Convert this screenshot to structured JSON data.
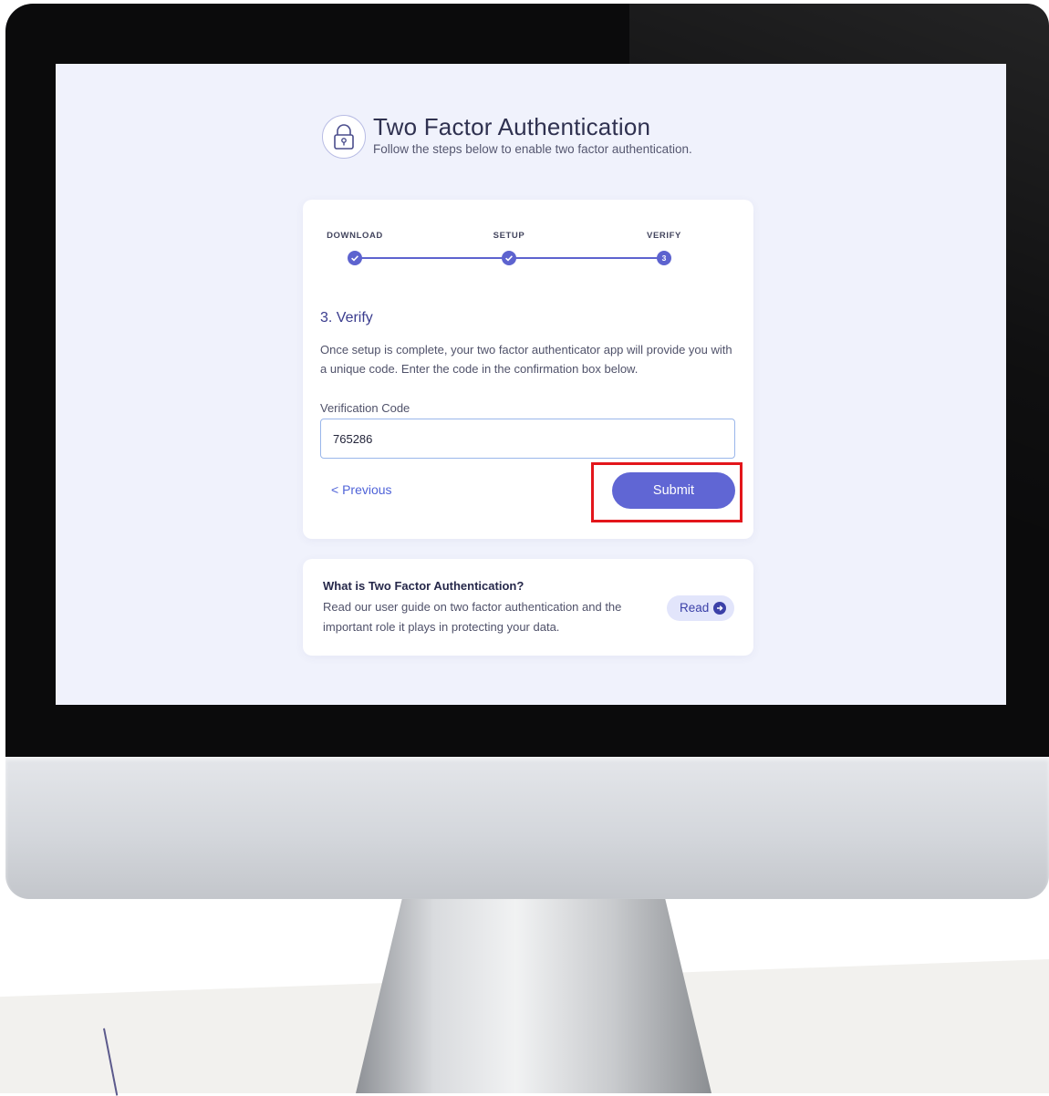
{
  "header": {
    "title": "Two Factor Authentication",
    "subtitle": "Follow the steps below to enable two factor authentication."
  },
  "stepper": {
    "steps": [
      {
        "label": "DOWNLOAD",
        "status": "complete"
      },
      {
        "label": "SETUP",
        "status": "complete"
      },
      {
        "label": "VERIFY",
        "status": "current",
        "number": "3"
      }
    ]
  },
  "verify": {
    "heading": "3. Verify",
    "description": "Once setup is complete, your two factor authenticator app will provide you with a unique code. Enter the code in the confirmation box below.",
    "field_label": "Verification Code",
    "code_value": "765286",
    "previous_label": "< Previous",
    "submit_label": "Submit"
  },
  "info": {
    "title": "What is Two Factor Authentication?",
    "text": "Read our user guide on two factor authentication and the important role it plays in protecting your data.",
    "read_label": "Read"
  },
  "colors": {
    "accent": "#6066d4",
    "screen_background": "#f0f2fc",
    "highlight": "#e3161b"
  }
}
